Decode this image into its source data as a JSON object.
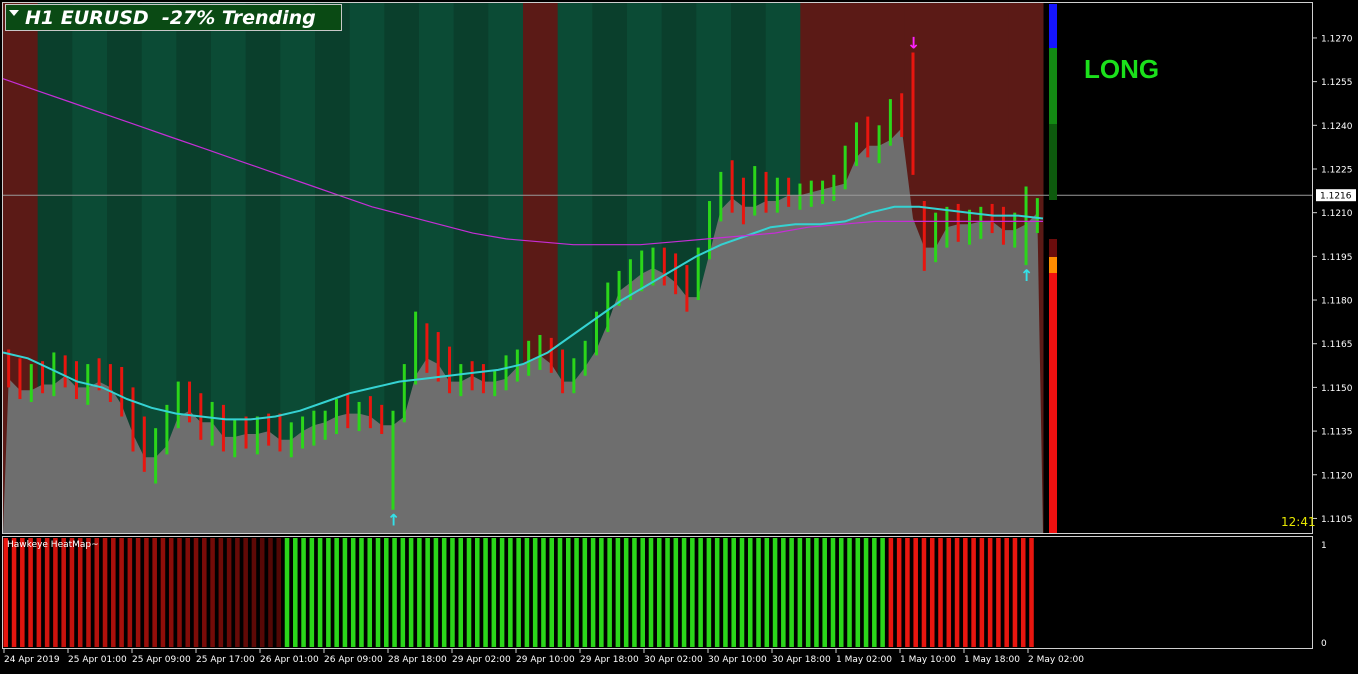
{
  "header": {
    "title": "H1 EURUSD  -27% Trending",
    "signal": "LONG",
    "clock": "12:41",
    "indicator_name": "Hawkeye HeatMap~"
  },
  "colors": {
    "signal": "#1be01b",
    "clock": "#e6e600",
    "bg_green": "#0b4b35",
    "bg_green_alt": "#0a3f2c",
    "bg_red": "#5b1a16",
    "price_fill": "#6e6e6e",
    "band_orange": "#ffa500",
    "band_cyan": "#00ffff",
    "ma_cyan": "#35d2d2",
    "ma_magenta": "#c52ed6",
    "bull_bar": "#2bd61a",
    "bear_bar": "#e8160f"
  },
  "chart_data": [
    {
      "type": "bar",
      "symbol": "EURUSD",
      "timeframe": "H1",
      "ylim": [
        1.11,
        1.1282
      ],
      "y_ticks": [
        "1.1270",
        "1.1255",
        "1.1240",
        "1.1225",
        "1.1210",
        "1.1195",
        "1.1180",
        "1.1165",
        "1.1150",
        "1.1135",
        "1.1120",
        "1.1105"
      ],
      "x_ticks": [
        "24 Apr 2019",
        "25 Apr 01:00",
        "25 Apr 09:00",
        "25 Apr 17:00",
        "26 Apr 01:00",
        "26 Apr 09:00",
        "28 Apr 18:00",
        "29 Apr 02:00",
        "29 Apr 10:00",
        "29 Apr 18:00",
        "30 Apr 02:00",
        "30 Apr 10:00",
        "30 Apr 18:00",
        "1 May 02:00",
        "1 May 10:00",
        "1 May 18:00",
        "2 May 02:00"
      ],
      "current_price": "1.1216",
      "bars": [
        [
          1.1157,
          1.1163,
          1.115,
          1.1153
        ],
        [
          1.1153,
          1.116,
          1.1146,
          1.1149
        ],
        [
          1.1149,
          1.1158,
          1.1145,
          1.1155
        ],
        [
          1.1155,
          1.1159,
          1.1148,
          1.1151
        ],
        [
          1.1151,
          1.1162,
          1.1147,
          1.1158
        ],
        [
          1.1158,
          1.1161,
          1.115,
          1.1154
        ],
        [
          1.1154,
          1.1159,
          1.1146,
          1.115
        ],
        [
          1.115,
          1.1158,
          1.1144,
          1.1156
        ],
        [
          1.1156,
          1.116,
          1.1149,
          1.1152
        ],
        [
          1.1152,
          1.1158,
          1.1145,
          1.115
        ],
        [
          1.115,
          1.1157,
          1.114,
          1.1144
        ],
        [
          1.1144,
          1.115,
          1.1128,
          1.1134
        ],
        [
          1.1134,
          1.114,
          1.1121,
          1.1126
        ],
        [
          1.1126,
          1.1136,
          1.1117,
          1.113
        ],
        [
          1.113,
          1.1144,
          1.1127,
          1.114
        ],
        [
          1.114,
          1.1152,
          1.1136,
          1.1148
        ],
        [
          1.1148,
          1.1152,
          1.1138,
          1.1142
        ],
        [
          1.1142,
          1.1148,
          1.1132,
          1.1138
        ],
        [
          1.1138,
          1.1145,
          1.113,
          1.114
        ],
        [
          1.114,
          1.1144,
          1.1128,
          1.1133
        ],
        [
          1.1133,
          1.1139,
          1.1126,
          1.1136
        ],
        [
          1.1136,
          1.114,
          1.1129,
          1.1134
        ],
        [
          1.1134,
          1.114,
          1.1127,
          1.1137
        ],
        [
          1.1137,
          1.1141,
          1.113,
          1.1135
        ],
        [
          1.1135,
          1.1141,
          1.1128,
          1.1132
        ],
        [
          1.1132,
          1.1138,
          1.1126,
          1.1135
        ],
        [
          1.1135,
          1.114,
          1.1129,
          1.1137
        ],
        [
          1.1137,
          1.1142,
          1.113,
          1.1138
        ],
        [
          1.1138,
          1.1142,
          1.1132,
          1.114
        ],
        [
          1.114,
          1.1146,
          1.1134,
          1.1143
        ],
        [
          1.1143,
          1.1148,
          1.1136,
          1.1141
        ],
        [
          1.1141,
          1.1145,
          1.1135,
          1.1142
        ],
        [
          1.1142,
          1.1147,
          1.1136,
          1.114
        ],
        [
          1.114,
          1.1144,
          1.1134,
          1.1137
        ],
        [
          1.1137,
          1.1142,
          1.1108,
          1.114
        ],
        [
          1.114,
          1.1158,
          1.1138,
          1.1154
        ],
        [
          1.1154,
          1.1176,
          1.1151,
          1.1165
        ],
        [
          1.1165,
          1.1172,
          1.1155,
          1.116
        ],
        [
          1.116,
          1.1169,
          1.1152,
          1.1158
        ],
        [
          1.1158,
          1.1164,
          1.1148,
          1.1152
        ],
        [
          1.1152,
          1.1158,
          1.1147,
          1.1155
        ],
        [
          1.1155,
          1.1159,
          1.1149,
          1.1154
        ],
        [
          1.1154,
          1.1158,
          1.1148,
          1.1152
        ],
        [
          1.1152,
          1.1156,
          1.1147,
          1.1153
        ],
        [
          1.1153,
          1.1161,
          1.1149,
          1.1157
        ],
        [
          1.1157,
          1.1163,
          1.1152,
          1.1159
        ],
        [
          1.1159,
          1.1166,
          1.1154,
          1.1161
        ],
        [
          1.1161,
          1.1168,
          1.1156,
          1.1163
        ],
        [
          1.1163,
          1.1167,
          1.1155,
          1.1158
        ],
        [
          1.1158,
          1.1163,
          1.1148,
          1.1152
        ],
        [
          1.1152,
          1.116,
          1.1148,
          1.1157
        ],
        [
          1.1157,
          1.1166,
          1.1154,
          1.1163
        ],
        [
          1.1163,
          1.1176,
          1.1161,
          1.1172
        ],
        [
          1.1172,
          1.1186,
          1.1169,
          1.1183
        ],
        [
          1.1183,
          1.119,
          1.1178,
          1.1186
        ],
        [
          1.1186,
          1.1194,
          1.118,
          1.1189
        ],
        [
          1.1189,
          1.1197,
          1.1183,
          1.1191
        ],
        [
          1.1191,
          1.1198,
          1.1185,
          1.1193
        ],
        [
          1.1193,
          1.1198,
          1.1185,
          1.1189
        ],
        [
          1.1189,
          1.1196,
          1.1182,
          1.1186
        ],
        [
          1.1186,
          1.1192,
          1.1176,
          1.1181
        ],
        [
          1.1181,
          1.1198,
          1.118,
          1.1196
        ],
        [
          1.1196,
          1.1214,
          1.1194,
          1.1211
        ],
        [
          1.1211,
          1.1224,
          1.1207,
          1.1218
        ],
        [
          1.1218,
          1.1228,
          1.121,
          1.1215
        ],
        [
          1.1215,
          1.1222,
          1.1206,
          1.1212
        ],
        [
          1.1212,
          1.1226,
          1.1209,
          1.122
        ],
        [
          1.122,
          1.1224,
          1.121,
          1.1214
        ],
        [
          1.1214,
          1.1222,
          1.121,
          1.1218
        ],
        [
          1.1218,
          1.1222,
          1.1212,
          1.1216
        ],
        [
          1.1216,
          1.122,
          1.1211,
          1.1217
        ],
        [
          1.1217,
          1.1221,
          1.1212,
          1.1218
        ],
        [
          1.1218,
          1.1221,
          1.1213,
          1.1219
        ],
        [
          1.1219,
          1.1223,
          1.1214,
          1.122
        ],
        [
          1.122,
          1.1233,
          1.1218,
          1.1229
        ],
        [
          1.1229,
          1.1241,
          1.1226,
          1.1236
        ],
        [
          1.1236,
          1.1243,
          1.1229,
          1.1233
        ],
        [
          1.1233,
          1.124,
          1.1227,
          1.1235
        ],
        [
          1.1235,
          1.1249,
          1.1233,
          1.1245
        ],
        [
          1.1245,
          1.1251,
          1.1236,
          1.1239
        ],
        [
          1.1239,
          1.1265,
          1.1223,
          1.1208
        ],
        [
          1.1208,
          1.1214,
          1.119,
          1.1198
        ],
        [
          1.1198,
          1.121,
          1.1193,
          1.1205
        ],
        [
          1.1205,
          1.1212,
          1.1198,
          1.1208
        ],
        [
          1.1208,
          1.1213,
          1.12,
          1.1206
        ],
        [
          1.1206,
          1.1211,
          1.1199,
          1.1207
        ],
        [
          1.1207,
          1.1212,
          1.1201,
          1.1209
        ],
        [
          1.1209,
          1.1213,
          1.1203,
          1.1207
        ],
        [
          1.1207,
          1.1212,
          1.1199,
          1.1204
        ],
        [
          1.1204,
          1.121,
          1.1198,
          1.1206
        ],
        [
          1.1206,
          1.1219,
          1.1192,
          1.121
        ],
        [
          1.121,
          1.1215,
          1.1203,
          1.1212
        ]
      ],
      "series": [
        {
          "values": [
            1.1162,
            1.116,
            1.1156,
            1.1152,
            1.115,
            1.1146,
            1.1143,
            1.1141,
            1.114,
            1.1139,
            1.1139,
            1.114,
            1.1142,
            1.1145,
            1.1148,
            1.115,
            1.1152,
            1.1153,
            1.1154,
            1.1155,
            1.1156,
            1.1158,
            1.1162,
            1.1168,
            1.1174,
            1.118,
            1.1185,
            1.119,
            1.1195,
            1.1199,
            1.1202,
            1.1205,
            1.1206,
            1.1206,
            1.1207,
            1.121,
            1.1212,
            1.1212,
            1.1211,
            1.121,
            1.1209,
            1.1209,
            1.1208
          ]
        },
        {
          "values": [
            1.1256,
            1.1252,
            1.1248,
            1.1244,
            1.124,
            1.1236,
            1.1232,
            1.1228,
            1.1224,
            1.122,
            1.1216,
            1.1212,
            1.1209,
            1.1206,
            1.1203,
            1.1201,
            1.12,
            1.1199,
            1.1199,
            1.1199,
            1.12,
            1.1201,
            1.1202,
            1.1203,
            1.1205,
            1.1206,
            1.1207,
            1.1207,
            1.1207,
            1.1207,
            1.1207,
            1.1207
          ]
        }
      ],
      "background_zones": [
        "red",
        "green",
        "green",
        "green",
        "green",
        "green",
        "green",
        "green",
        "green",
        "green",
        "green",
        "green",
        "green",
        "green",
        "green",
        "red",
        "green",
        "green",
        "green",
        "green",
        "green",
        "green",
        "green",
        "red",
        "red",
        "red",
        "red",
        "red",
        "red",
        "red"
      ],
      "arrows": [
        {
          "bar": 34,
          "direction": "up"
        },
        {
          "bar": 80,
          "direction": "down"
        },
        {
          "bar": 90,
          "direction": "up"
        }
      ]
    },
    {
      "type": "bar",
      "name": "Hawkeye HeatMap~",
      "ylim": [
        0,
        1
      ],
      "y_ticks": [
        "1",
        "0"
      ],
      "histogram": [
        "red",
        "red",
        "red",
        "red",
        "red",
        "red",
        "red",
        "red",
        "red",
        "red",
        "red",
        "red",
        "red",
        "red",
        "red",
        "red",
        "red",
        "red",
        "red",
        "red",
        "red",
        "red",
        "red",
        "red",
        "red",
        "red",
        "red",
        "red",
        "red",
        "red",
        "red",
        "red",
        "red",
        "red",
        "green",
        "green",
        "green",
        "green",
        "green",
        "green",
        "green",
        "green",
        "green",
        "green",
        "green",
        "green",
        "green",
        "green",
        "green",
        "green",
        "green",
        "green",
        "green",
        "green",
        "green",
        "green",
        "green",
        "green",
        "green",
        "green",
        "green",
        "green",
        "green",
        "green",
        "green",
        "green",
        "green",
        "green",
        "green",
        "green",
        "green",
        "green",
        "green",
        "green",
        "green",
        "green",
        "green",
        "green",
        "green",
        "green",
        "green",
        "green",
        "green",
        "green",
        "green",
        "green",
        "green",
        "green",
        "green",
        "green",
        "green",
        "green",
        "green",
        "green",
        "green",
        "green",
        "green",
        "green",
        "green",
        "green",
        "green",
        "green",
        "green",
        "green",
        "green",
        "green",
        "green",
        "red",
        "red",
        "red",
        "red",
        "red",
        "red",
        "red",
        "red",
        "red",
        "red",
        "red",
        "red",
        "red",
        "red",
        "red",
        "red",
        "red",
        "red"
      ]
    }
  ]
}
